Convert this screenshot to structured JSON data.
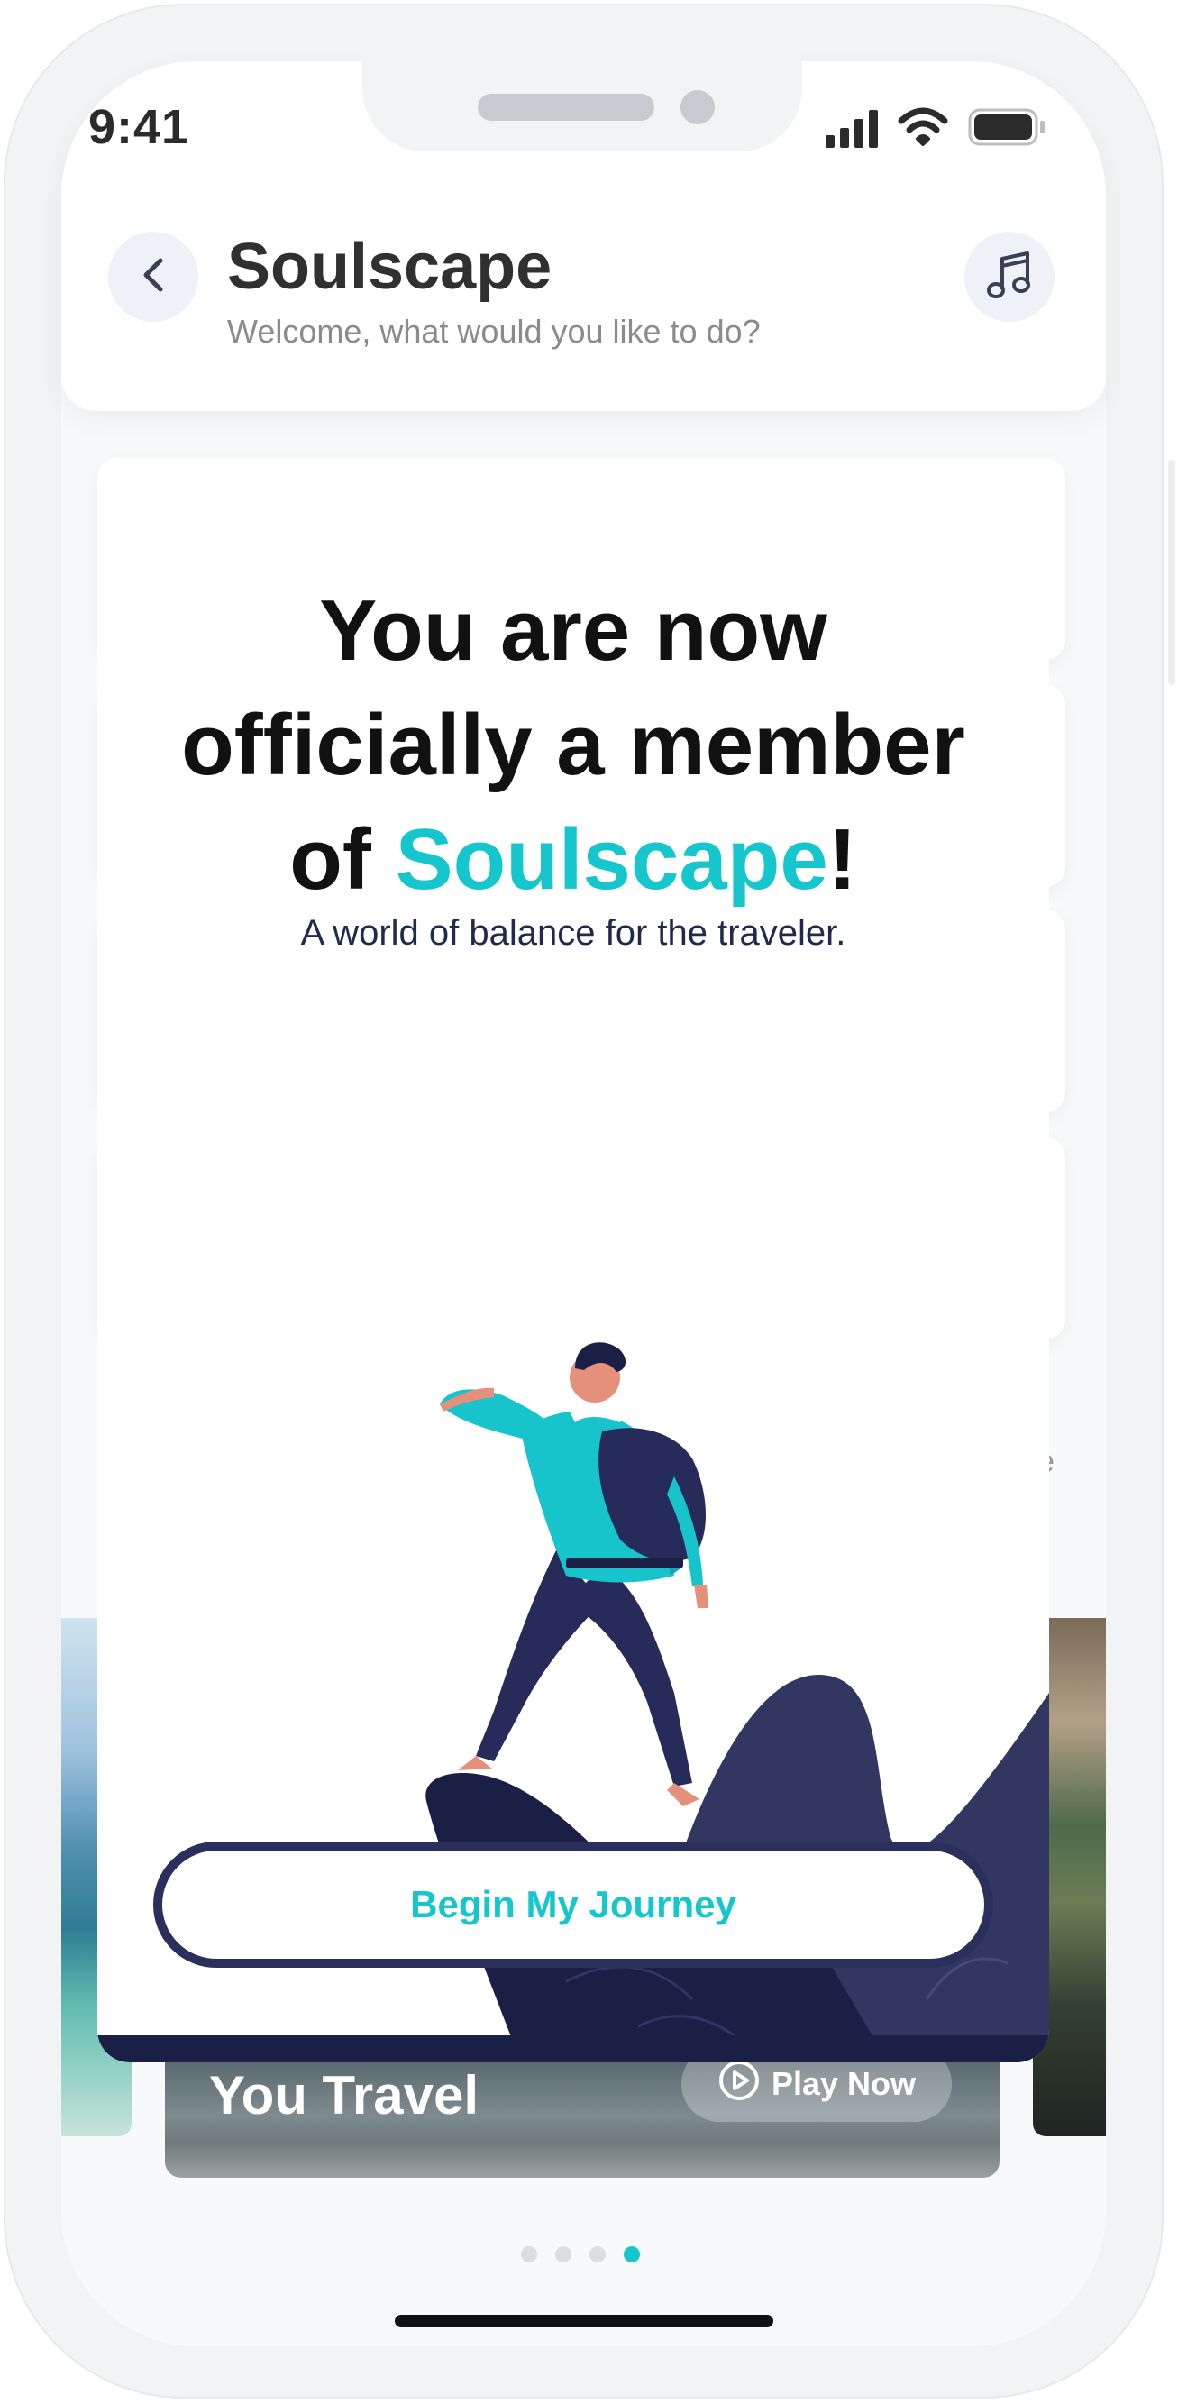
{
  "status_bar": {
    "time": "9:41"
  },
  "header": {
    "title": "Soulscape",
    "subtitle": "Welcome, what would you like to do?"
  },
  "modal": {
    "headline_line1": "You are now",
    "headline_line2": "officially a member",
    "headline_of": "of ",
    "headline_accent": "Soulscape",
    "headline_end": "!",
    "tagline": "A world of balance for the traveler.",
    "button_label": "Begin My Journey"
  },
  "background": {
    "text_fragment": "e",
    "featured_card": {
      "title": "You Travel",
      "play_label": "Play Now"
    }
  },
  "pagination": {
    "count": 4,
    "active_index": 3
  },
  "colors": {
    "accent": "#15c7cc",
    "navy": "#1a1f45",
    "mountain": "#323762",
    "text_dark": "#111111"
  },
  "icons": [
    "chevron-left-icon",
    "music-note-icon",
    "signal-icon",
    "wifi-icon",
    "battery-icon",
    "play-circle-icon"
  ]
}
